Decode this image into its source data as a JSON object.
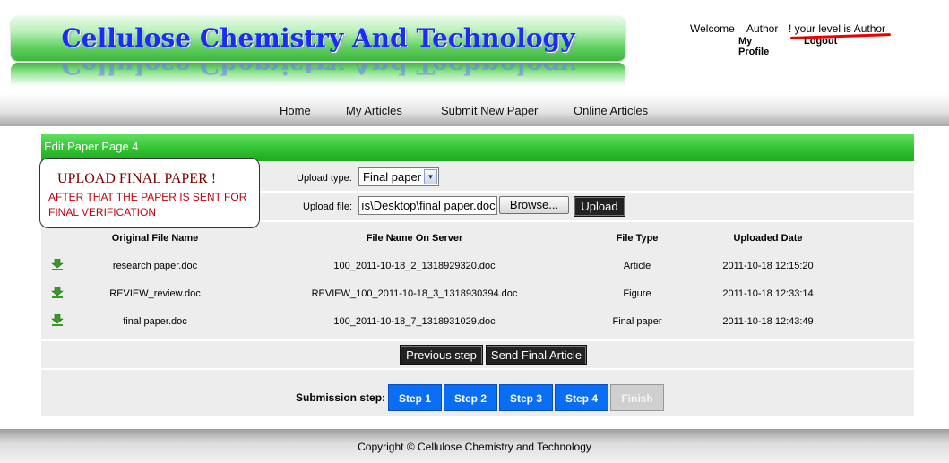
{
  "site": {
    "title": "Cellulose Chemistry And Technology"
  },
  "user": {
    "welcome": "Welcome",
    "name": "Author",
    "level_text": "! your level is Author",
    "my_profile": "My Profile",
    "logout": "Logout"
  },
  "nav": {
    "home": "Home",
    "my_articles": "My Articles",
    "submit_new_paper": "Submit New Paper",
    "online_articles": "Online Articles"
  },
  "panel": {
    "title": "Edit Paper Page 4"
  },
  "callout": {
    "title": "UPLOAD FINAL PAPER !",
    "text": "AFTER THAT THE PAPER IS SENT FOR FINAL VERIFICATION"
  },
  "upload": {
    "type_label": "Upload type:",
    "type_value": "Final paper",
    "file_label": "Upload file:",
    "file_value": "ıs\\Desktop\\final paper.doc",
    "browse_label": "Browse...",
    "upload_label": "Upload"
  },
  "table": {
    "headers": [
      "Original File Name",
      "File Name On Server",
      "File Type",
      "Uploaded Date"
    ],
    "rows": [
      {
        "original": "research paper.doc",
        "server": "100_2011-10-18_2_1318929320.doc",
        "type": "Article",
        "date": "2011-10-18 12:15:20"
      },
      {
        "original": "REVIEW_review.doc",
        "server": "REVIEW_100_2011-10-18_3_1318930394.doc",
        "type": "Figure",
        "date": "2011-10-18 12:33:14"
      },
      {
        "original": "final paper.doc",
        "server": "100_2011-10-18_7_1318931029.doc",
        "type": "Final paper",
        "date": "2011-10-18 12:43:49"
      }
    ]
  },
  "actions": {
    "previous": "Previous step",
    "send_final": "Send Final Article"
  },
  "steps": {
    "label": "Submission step:",
    "items": [
      "Step 1",
      "Step 2",
      "Step 3",
      "Step 4",
      "Finish"
    ]
  },
  "footer": {
    "copyright": "Copyright © Cellulose Chemistry and Technology"
  },
  "colors": {
    "header_green": "#2fbf2f",
    "step_blue": "#0a6ef5",
    "callout_red": "#c0000c"
  }
}
